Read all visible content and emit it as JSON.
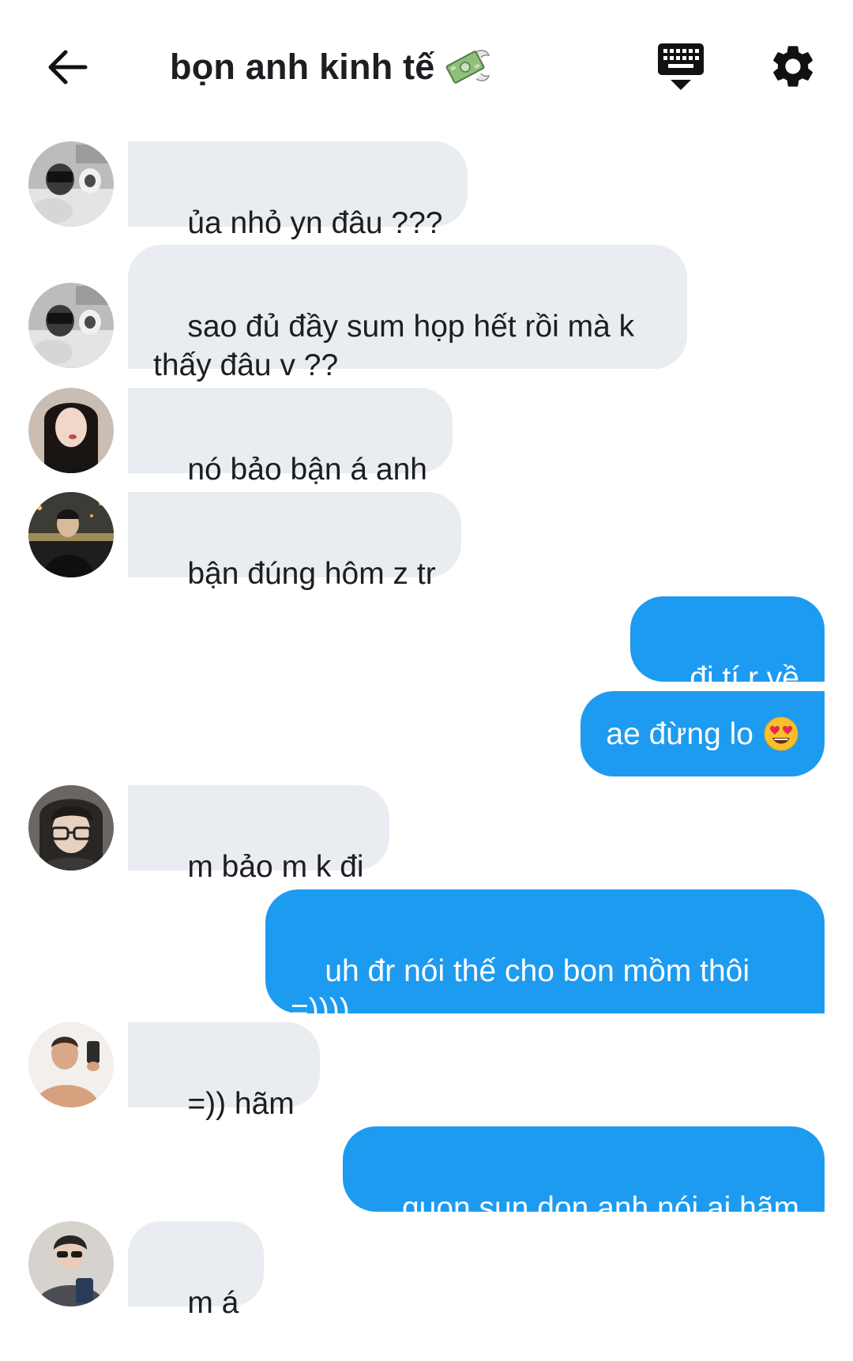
{
  "header": {
    "title": "bọn anh kinh tế",
    "title_icon": "money-with-wings-icon",
    "back_icon": "arrow-left-icon",
    "keyboard_icon": "keyboard-hide-icon",
    "settings_icon": "gear-icon"
  },
  "colors": {
    "incoming_bubble": "#e9ecf0",
    "outgoing_bubble": "#1d9bf0",
    "outgoing_text": "#ffffff"
  },
  "messages": [
    {
      "direction": "in",
      "text": "ủa nhỏ yn đâu ???"
    },
    {
      "direction": "in",
      "text": "sao đủ đầy sum họp hết rồi mà k\nthấy đâu v ??"
    },
    {
      "direction": "in",
      "text": "nó bảo bận á anh"
    },
    {
      "direction": "in",
      "text": "bận đúng hôm z tr"
    },
    {
      "direction": "out",
      "text": "đi tí r về"
    },
    {
      "direction": "out",
      "text": "ae đừng lo",
      "emoji": "heart-eyes-emoji"
    },
    {
      "direction": "in",
      "text": "m bảo m k đi"
    },
    {
      "direction": "out",
      "text": "uh đr nói thế cho bon mồm thôi\n=))))"
    },
    {
      "direction": "in",
      "text": "=)) hãm"
    },
    {
      "direction": "out",
      "text": "quon sun don anh nói ai hãm"
    },
    {
      "direction": "in",
      "text": "m á"
    }
  ]
}
